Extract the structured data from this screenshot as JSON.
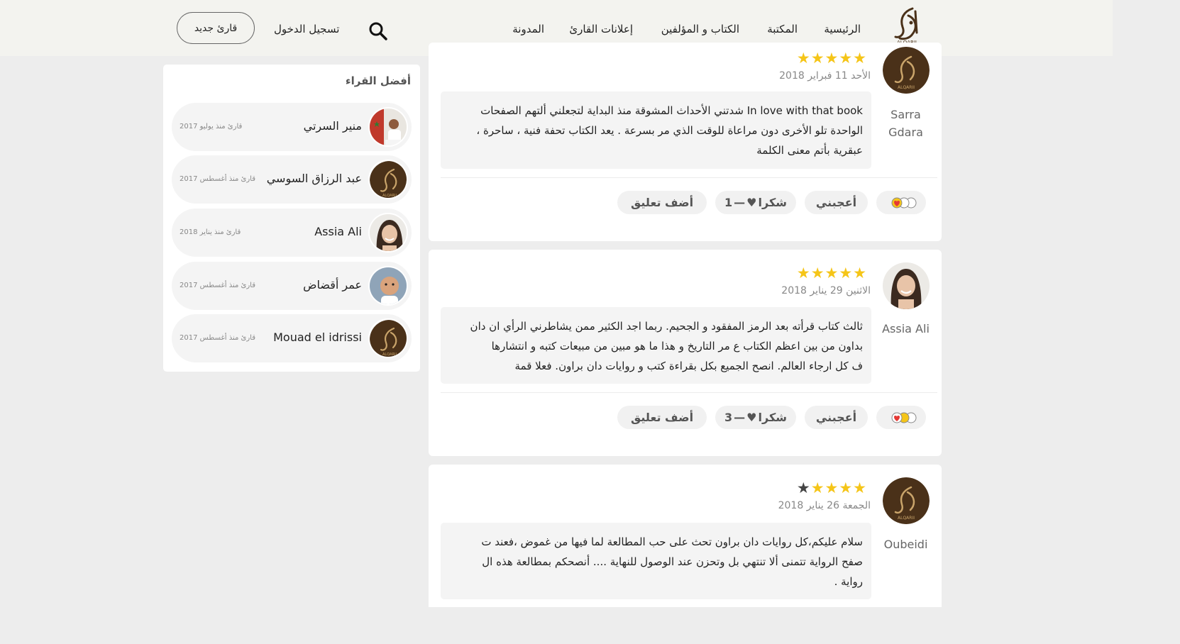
{
  "header": {
    "logo_text": "القارئ ALQARII",
    "nav": [
      "الرئيسية",
      "المكتبة",
      "الكتاب و المؤلفين",
      "إعلانات القارئ",
      "المدونة"
    ],
    "login_label": "تسجيل الدخول",
    "new_reader_label": "قارئ جديد"
  },
  "sidebar": {
    "title": "أفضل القراء",
    "readers": [
      {
        "name": "منير السرتي",
        "since": "قارئ منذ يوليو 2017"
      },
      {
        "name": "عبد الرزاق السوسي",
        "since": "قارئ منذ أغسطس 2017"
      },
      {
        "name": "Assia Ali",
        "since": "قارئ منذ يناير 2018"
      },
      {
        "name": "عمر أقضاض",
        "since": "قارئ منذ أغسطس 2017"
      },
      {
        "name": "Mouad el idrissi",
        "since": "قارئ منذ أغسطس 2017"
      }
    ]
  },
  "reviews": [
    {
      "name_line1": "Sarra",
      "name_line2": "Gdara",
      "rating": 5,
      "date": "الأحد 11 فبراير 2018",
      "lines": [
        "In love with that book شدتني الأحداث المشوقة منذ البداية لتجعلني ألتهم الصفحات",
        "الواحدة تلو الأخرى دون مراعاة للوقت الذي مر بسرعة . يعد الكتاب تحفة فنية ، ساحرة ،",
        "عبقرية بأتم معنى الكلمة"
      ],
      "like_label": "أعجبني",
      "thanks_label": "شكرا",
      "thanks_count": "1",
      "comment_label": "أضف تعليق"
    },
    {
      "name_line1": "Assia Ali",
      "name_line2": "",
      "rating": 5,
      "date": "الاثنين 29 يناير 2018",
      "lines": [
        "ثالث كتاب قرأته بعد الرمز المفقود و الجحيم. ربما اجد الكثير ممن يشاطرني الرأي ان دان",
        "بداون من بين اعظم الكتاب ع مر التاريخ و هذا ما هو مبين من مبيعات كتبه و انتشارها",
        "ف كل ارجاء العالم. انصح الجميع بكل بقراءة كتب و روايات دان براون. فعلا قمة"
      ],
      "like_label": "أعجبني",
      "thanks_label": "شكرا",
      "thanks_count": "3",
      "comment_label": "أضف تعليق"
    },
    {
      "name_line1": "Oubeidi",
      "name_line2": "",
      "rating": 4,
      "date": "الجمعة 26 يناير 2018",
      "lines": [
        "سلام عليكم،كل روايات دان براون تحث على حب المطالعة لما فيها من غموض ،فعند ت",
        "صفح الرواية تتمنى ألا تنتهي بل وتحزن عند الوصول للنهاية .... أنصحكم بمطالعة هذه ال",
        "رواية ."
      ]
    }
  ],
  "colors": {
    "star": "#f5c518",
    "brand_brown": "#4a3119",
    "gold": "#c9a46a"
  }
}
